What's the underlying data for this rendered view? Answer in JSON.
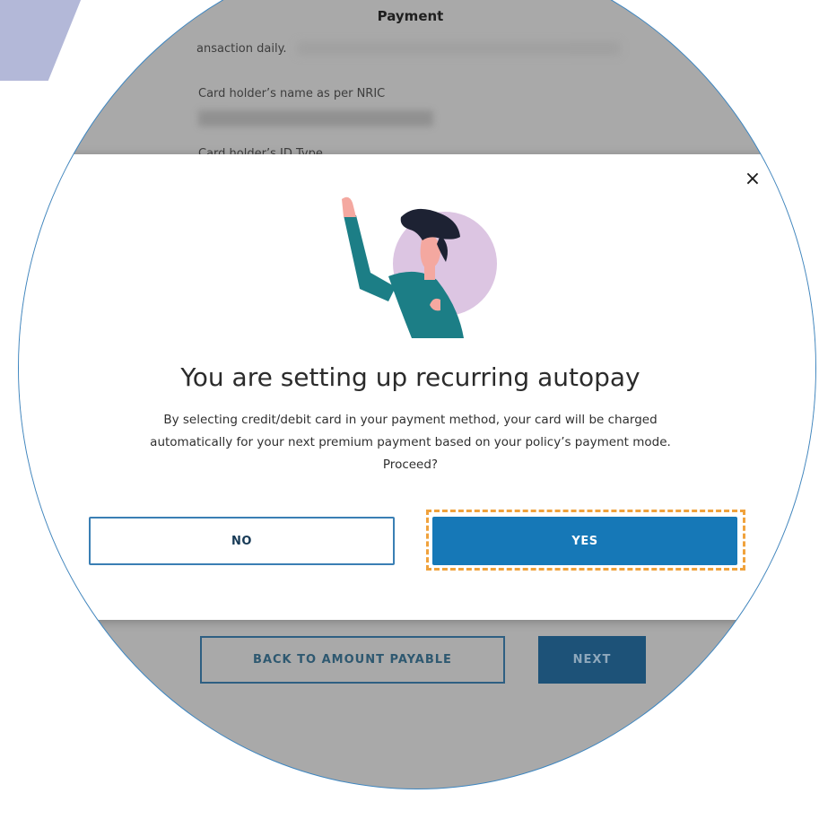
{
  "page": {
    "title": "Payment",
    "partial_text": "ansaction daily.",
    "card_holder_name_label": "Card holder’s name as per NRIC",
    "card_holder_id_type_label": "Card holder’s ID Type"
  },
  "footer": {
    "back_label": "BACK TO AMOUNT PAYABLE",
    "next_label": "NEXT"
  },
  "modal": {
    "close_icon": "×",
    "title": "You are setting up recurring autopay",
    "body_line1": "By selecting credit/debit card in your payment method, your card will be charged",
    "body_line2": "automatically for your next premium payment based on your policy’s payment mode.",
    "body_line3": "Proceed?",
    "no_label": "NO",
    "yes_label": "YES"
  },
  "colors": {
    "primary": "#1678b7",
    "highlight": "#f0a23c",
    "overlay": "#a9a9a9",
    "illustration_shirt": "#1c7e86",
    "illustration_circle": "#dcc5e2"
  }
}
